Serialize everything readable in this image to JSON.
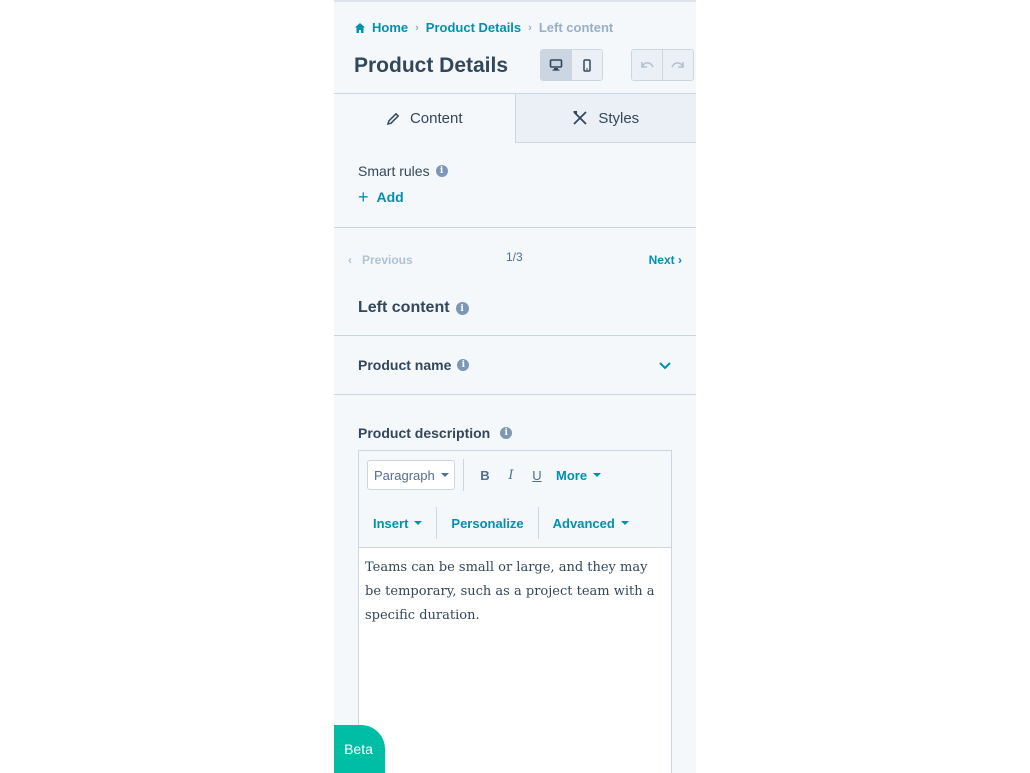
{
  "breadcrumb": {
    "home": "Home",
    "parent": "Product Details",
    "current": "Left content"
  },
  "header": {
    "title": "Product Details"
  },
  "tabs": [
    {
      "label": "Content",
      "icon": "pencil-icon",
      "active": true
    },
    {
      "label": "Styles",
      "icon": "brush-icon",
      "active": false
    }
  ],
  "smart_rules": {
    "label": "Smart rules",
    "add_label": "Add"
  },
  "pager": {
    "previous": "Previous",
    "count": "1/3",
    "next": "Next"
  },
  "section": {
    "title": "Left content"
  },
  "product_name": {
    "label": "Product name"
  },
  "product_description": {
    "label": "Product description",
    "toolbar": {
      "paragraph": "Paragraph",
      "bold": "B",
      "italic": "I",
      "underline": "U",
      "more": "More",
      "insert": "Insert",
      "personalize": "Personalize",
      "advanced": "Advanced"
    },
    "content": "Teams can be small or large, and they may be temporary, such as a project team with a specific duration."
  },
  "beta_label": "Beta",
  "colors": {
    "accent": "#0091ae",
    "beta": "#00bda5",
    "text": "#33475b",
    "panel": "#f5f8fa"
  }
}
